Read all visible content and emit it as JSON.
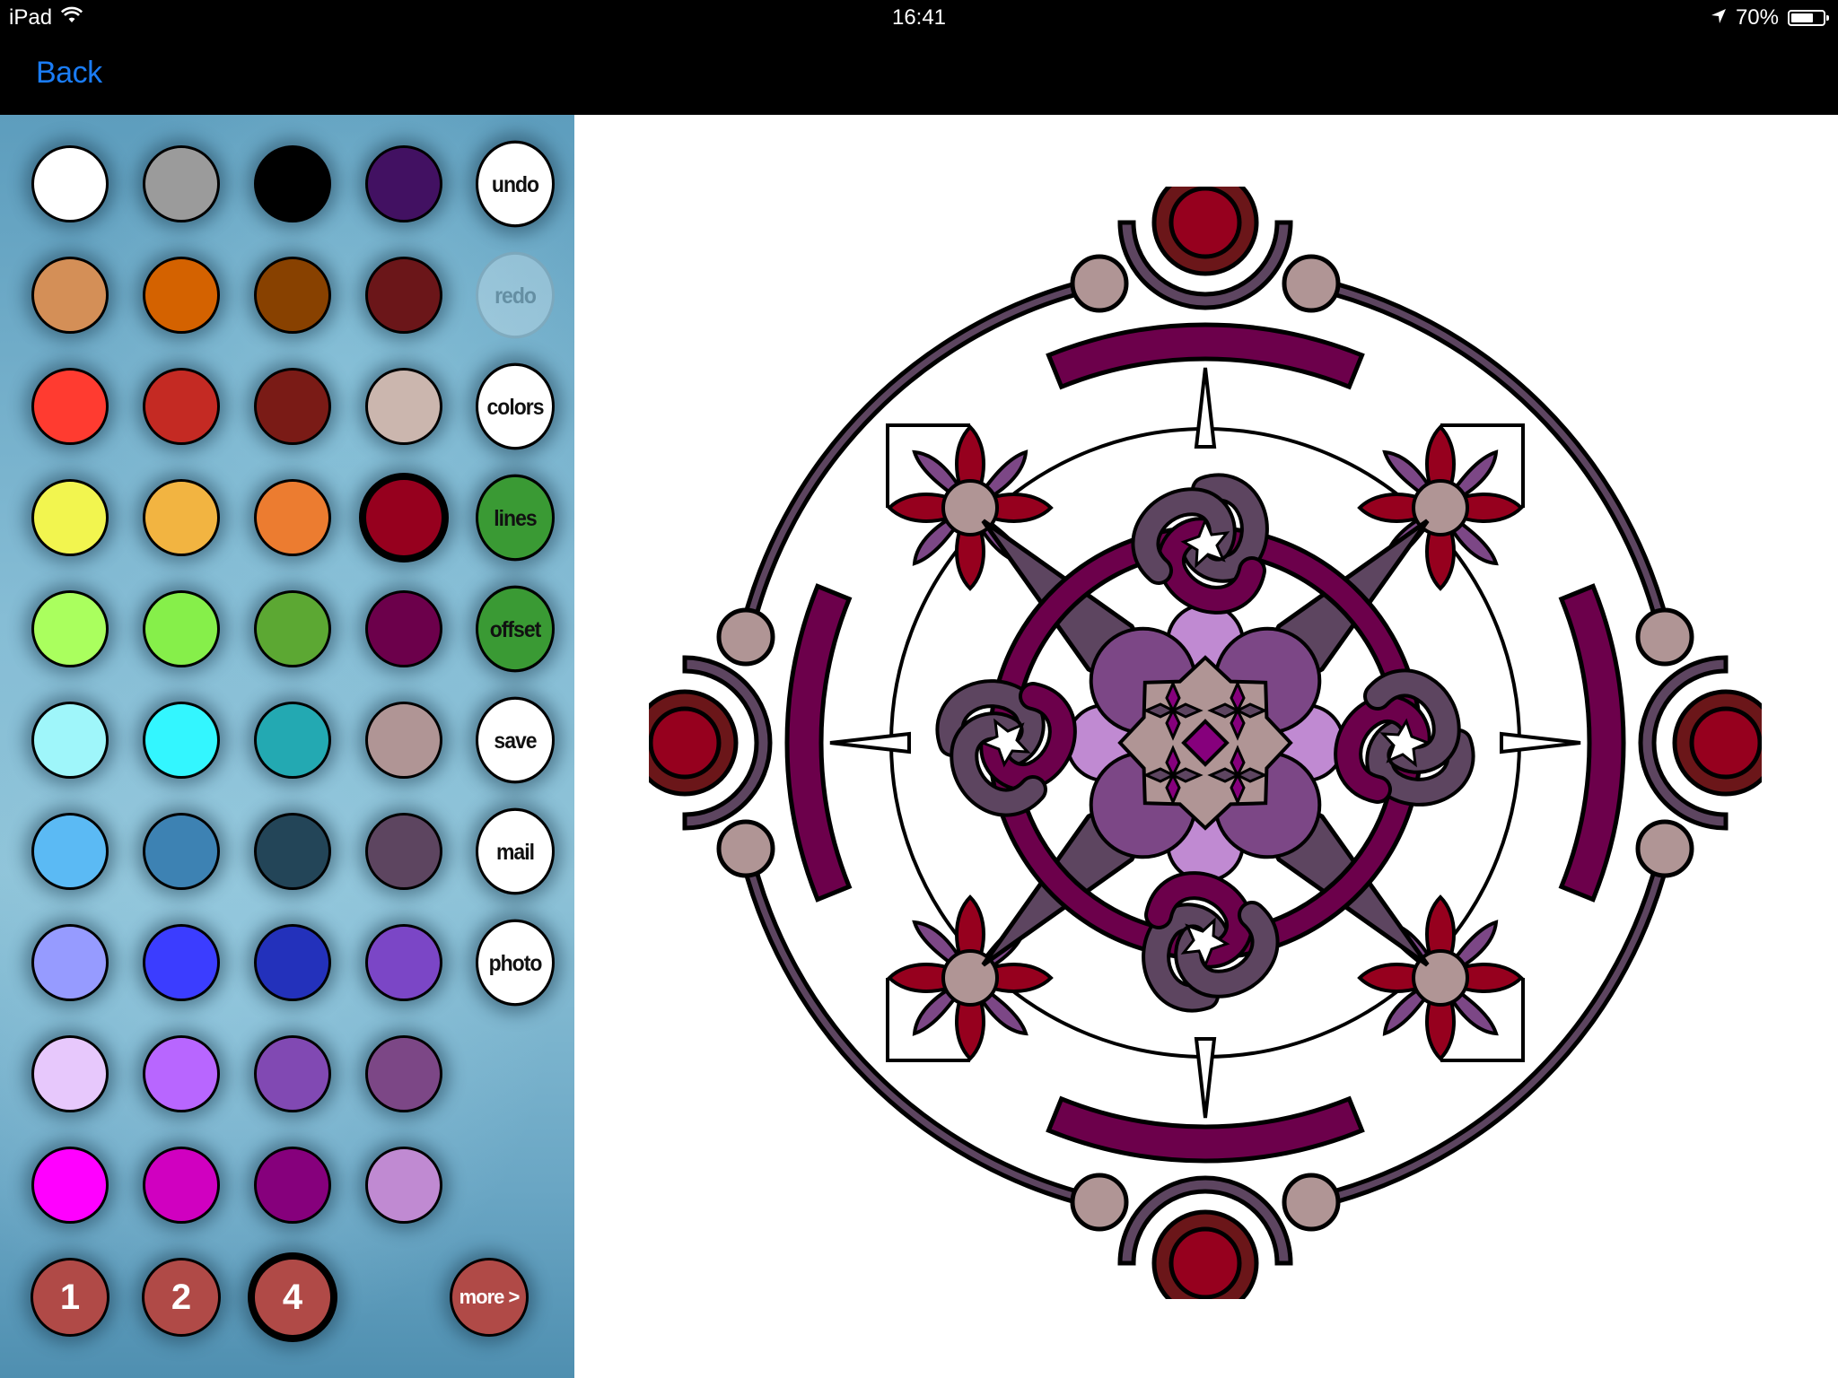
{
  "status_bar": {
    "device": "iPad",
    "wifi_icon": "wifi-icon",
    "time": "16:41",
    "location_icon": "location-arrow-icon",
    "battery_text": "70%",
    "battery_level": 0.7
  },
  "nav": {
    "back_label": "Back",
    "accent": "#1a7cf5"
  },
  "palette": {
    "swatches": [
      [
        "#ffffff",
        "#9b9b9b",
        "#000000",
        "#421162"
      ],
      [
        "#d48f57",
        "#d46200",
        "#884100",
        "#6b1619"
      ],
      [
        "#ff3b30",
        "#c42a23",
        "#7a1b16",
        "#cbb6ae"
      ],
      [
        "#f2f54f",
        "#f2b441",
        "#ec7c30",
        "#96001e"
      ],
      [
        "#aaff5e",
        "#86ef4a",
        "#5ca833",
        "#6c004b"
      ],
      [
        "#9ff6fa",
        "#33f6ff",
        "#23a9b2",
        "#b09595"
      ],
      [
        "#5bbaf4",
        "#3d82b3",
        "#234558",
        "#5d4560"
      ],
      [
        "#969bff",
        "#3b3dff",
        "#2331bb",
        "#7b46c6"
      ],
      [
        "#e7c8fc",
        "#b866ff",
        "#8149b3",
        "#7c4786"
      ],
      [
        "#ff00ff",
        "#d000c0",
        "#86007c",
        "#c08ad2"
      ]
    ],
    "selected_color": "#96001e",
    "tools": [
      {
        "label": "undo",
        "state": "enabled",
        "style": "white"
      },
      {
        "label": "redo",
        "state": "disabled",
        "style": "white"
      },
      {
        "label": "colors",
        "state": "enabled",
        "style": "white"
      },
      {
        "label": "lines",
        "state": "enabled",
        "style": "green"
      },
      {
        "label": "offset",
        "state": "enabled",
        "style": "green"
      },
      {
        "label": "save",
        "state": "enabled",
        "style": "white"
      },
      {
        "label": "mail",
        "state": "enabled",
        "style": "white"
      },
      {
        "label": "photo",
        "state": "enabled",
        "style": "white"
      }
    ],
    "brush_sizes": [
      "1",
      "2",
      "4"
    ],
    "selected_brush": "4",
    "more_label": "more >"
  },
  "mandala_colors": {
    "outline": "#000000",
    "plum": "#6c004b",
    "mauve_gray": "#5d4560",
    "dark_red": "#6b1619",
    "crimson": "#96001e",
    "rosy_gray": "#b09595",
    "violet": "#7c4786",
    "lilac": "#c08ad2",
    "magenta_dark": "#86007c"
  }
}
